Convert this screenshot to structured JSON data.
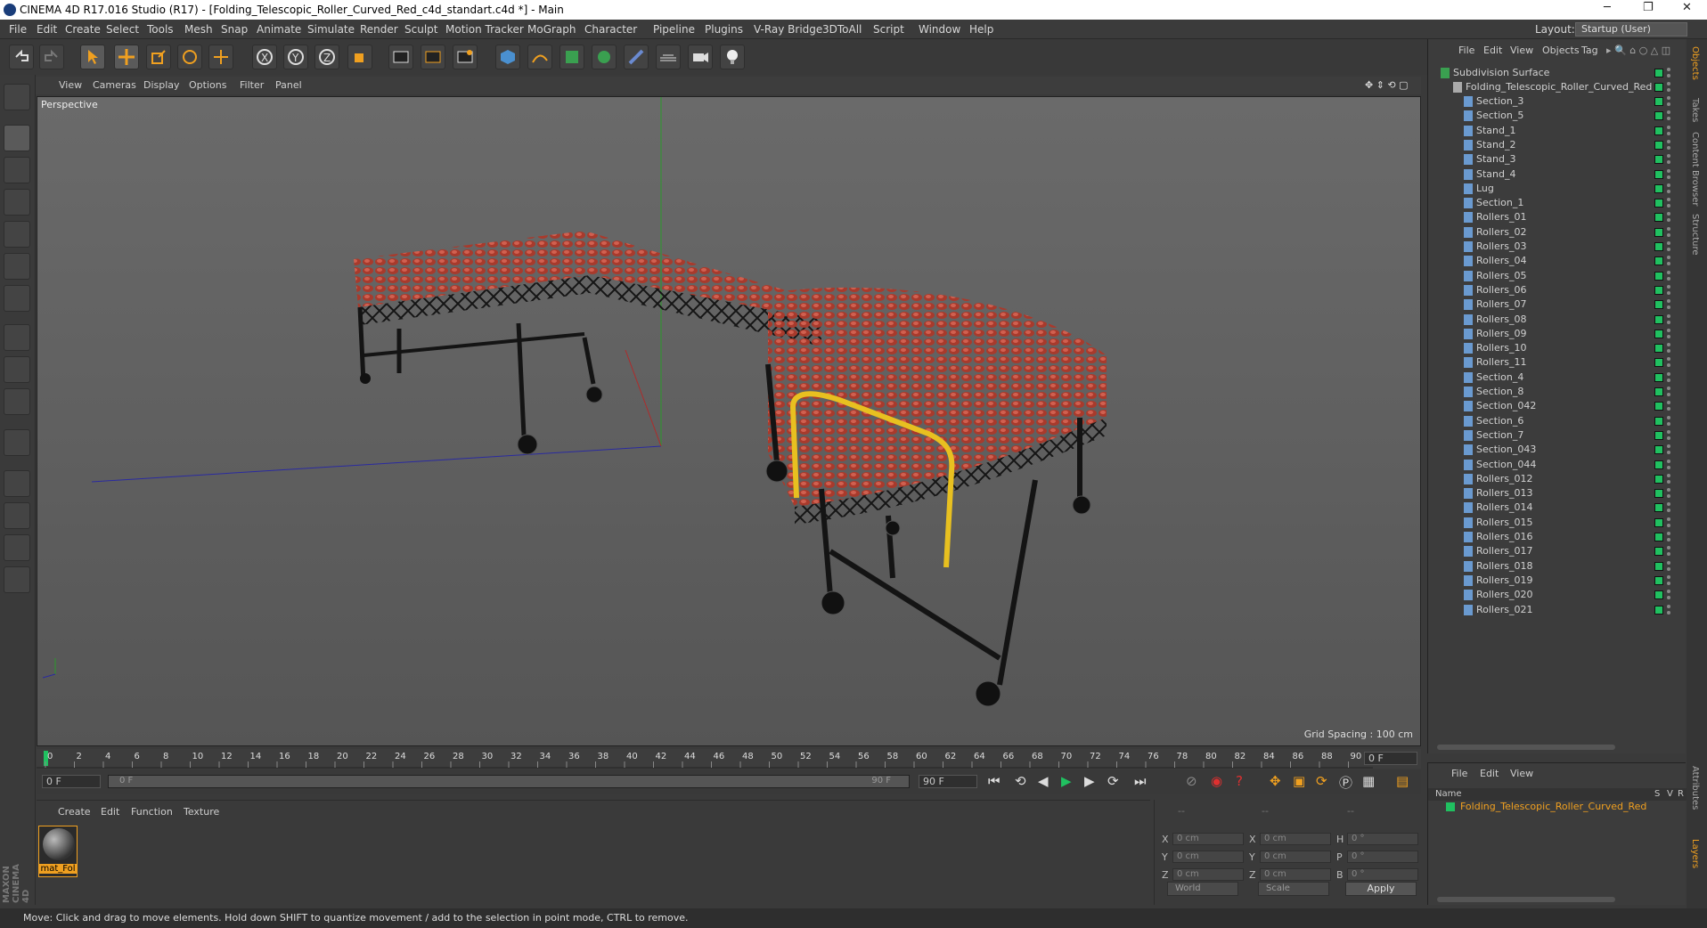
{
  "window": {
    "title": "CINEMA 4D R17.016 Studio (R17) - [Folding_Telescopic_Roller_Curved_Red_c4d_standart.c4d *] - Main",
    "layout_label": "Layout:",
    "layout_value": "Startup (User)"
  },
  "menubar": [
    "File",
    "Edit",
    "Create",
    "Select",
    "Tools",
    "Mesh",
    "Snap",
    "Animate",
    "Simulate",
    "Render",
    "Sculpt",
    "Motion Tracker",
    "MoGraph",
    "Character",
    "Pipeline",
    "Plugins",
    "V-Ray Bridge",
    "3DToAll",
    "Script",
    "Window",
    "Help"
  ],
  "viewport": {
    "menu": [
      "View",
      "Cameras",
      "Display",
      "Options",
      "Filter",
      "Panel"
    ],
    "camera_label": "Perspective",
    "grid_spacing": "Grid Spacing : 100 cm"
  },
  "timeline": {
    "ticks": [
      "0",
      "2",
      "4",
      "6",
      "8",
      "10",
      "12",
      "14",
      "16",
      "18",
      "20",
      "22",
      "24",
      "26",
      "28",
      "30",
      "32",
      "34",
      "36",
      "38",
      "40",
      "42",
      "44",
      "46",
      "48",
      "50",
      "52",
      "54",
      "56",
      "58",
      "60",
      "62",
      "64",
      "66",
      "68",
      "70",
      "72",
      "74",
      "76",
      "78",
      "80",
      "82",
      "84",
      "86",
      "88",
      "90"
    ],
    "current_frame": "0 F",
    "start_frame": "0 F",
    "range_start": "0 F",
    "range_end": "90 F",
    "end_frame": "90 F"
  },
  "material_panel": {
    "menu": [
      "Create",
      "Edit",
      "Function",
      "Texture"
    ],
    "material_name": "mat_Fol"
  },
  "coords": {
    "header": [
      "--",
      "--",
      "--"
    ],
    "rows": [
      {
        "a": "X",
        "av": "0 cm",
        "b": "X",
        "bv": "0 cm",
        "c": "H",
        "cv": "0 °"
      },
      {
        "a": "Y",
        "av": "0 cm",
        "b": "Y",
        "bv": "0 cm",
        "c": "P",
        "cv": "0 °"
      },
      {
        "a": "Z",
        "av": "0 cm",
        "b": "Z",
        "bv": "0 cm",
        "c": "B",
        "cv": "0 °"
      }
    ],
    "world": "World",
    "scale": "Scale",
    "apply": "Apply"
  },
  "object_manager": {
    "menu": [
      "File",
      "Edit",
      "View",
      "Objects",
      "Tag"
    ],
    "root": "Subdivision Surface",
    "group": "Folding_Telescopic_Roller_Curved_Red",
    "children": [
      "Section_3",
      "Section_5",
      "Stand_1",
      "Stand_2",
      "Stand_3",
      "Stand_4",
      "Lug",
      "Section_1",
      "Rollers_01",
      "Rollers_02",
      "Rollers_03",
      "Rollers_04",
      "Rollers_05",
      "Rollers_06",
      "Rollers_07",
      "Rollers_08",
      "Rollers_09",
      "Rollers_10",
      "Rollers_11",
      "Section_4",
      "Section_8",
      "Section_042",
      "Section_6",
      "Section_7",
      "Section_043",
      "Section_044",
      "Rollers_012",
      "Rollers_013",
      "Rollers_014",
      "Rollers_015",
      "Rollers_016",
      "Rollers_017",
      "Rollers_018",
      "Rollers_019",
      "Rollers_020",
      "Rollers_021"
    ]
  },
  "layer_manager": {
    "menu": [
      "File",
      "Edit",
      "View"
    ],
    "col_name": "Name",
    "cols": [
      "S",
      "V",
      "R"
    ],
    "item": "Folding_Telescopic_Roller_Curved_Red"
  },
  "right_tabs": [
    "Objects",
    "Takes",
    "Content Browser",
    "Structure",
    "Attributes",
    "Layers"
  ],
  "status": "Move: Click and drag to move elements. Hold down SHIFT to quantize movement / add to the selection in point mode, CTRL to remove.",
  "maxon_logo": "MAXON CINEMA 4D",
  "colors": {
    "accent": "#f0a020",
    "tag_green": "#20c060",
    "rail_yellow": "#e8c020",
    "roller_red": "#b04030"
  }
}
